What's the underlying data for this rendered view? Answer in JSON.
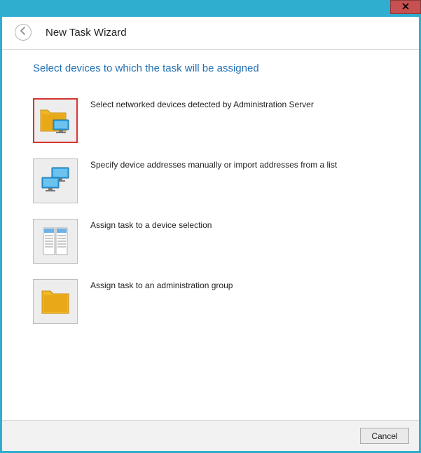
{
  "window": {
    "title": "New Task Wizard"
  },
  "page": {
    "heading": "Select devices to which the task will be assigned"
  },
  "options": [
    {
      "label": "Select networked devices detected by Administration Server",
      "selected": true
    },
    {
      "label": "Specify device addresses manually or import addresses from a list",
      "selected": false
    },
    {
      "label": "Assign task to a device selection",
      "selected": false
    },
    {
      "label": "Assign task to an administration group",
      "selected": false
    }
  ],
  "footer": {
    "cancel_label": "Cancel"
  }
}
